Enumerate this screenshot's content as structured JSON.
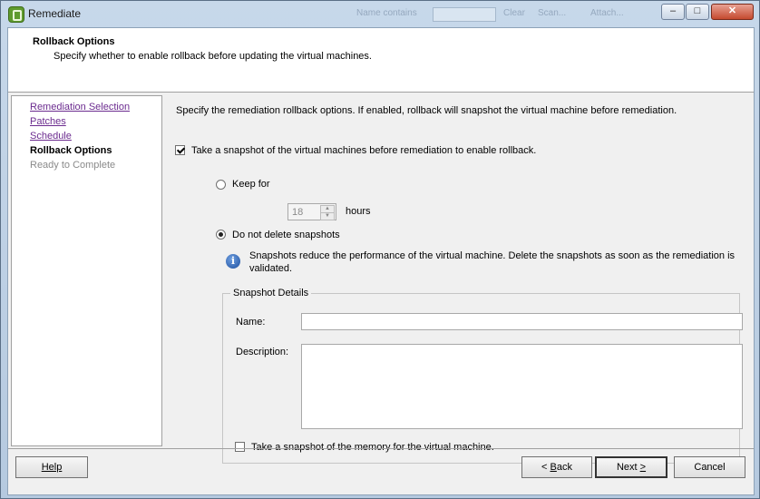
{
  "window": {
    "title": "Remediate",
    "ghost_text_1": "Name contains",
    "ghost_text_2": "Clear",
    "ghost_text_3": "Scan...",
    "ghost_text_4": "Attach...",
    "minimize_glyph": "–",
    "maximize_glyph": "□",
    "close_glyph": "✕"
  },
  "header": {
    "title": "Rollback Options",
    "subtitle": "Specify whether to enable rollback before updating the virtual machines."
  },
  "nav": {
    "items": [
      {
        "label": "Remediation Selection",
        "state": "link"
      },
      {
        "label": "Patches",
        "state": "link"
      },
      {
        "label": "Schedule",
        "state": "link"
      },
      {
        "label": "Rollback Options",
        "state": "current"
      },
      {
        "label": "Ready to Complete",
        "state": "disabled"
      }
    ]
  },
  "content": {
    "intro": "Specify the remediation rollback options. If enabled, rollback will snapshot the virtual machine before remediation.",
    "snapshot_checkbox": {
      "label": "Take a snapshot of the virtual machines before remediation to enable rollback.",
      "checked": true
    },
    "keep_for": {
      "label": "Keep for",
      "value": "18",
      "unit": "hours",
      "selected": false
    },
    "do_not_delete": {
      "label": "Do not delete snapshots",
      "selected": true
    },
    "info_icon": "info-icon",
    "info_text": "Snapshots reduce the performance of the virtual machine. Delete the snapshots as soon as the remediation is validated.",
    "details": {
      "legend": "Snapshot Details",
      "name_label": "Name:",
      "name_value": "",
      "description_label": "Description:",
      "description_value": "",
      "memory_checkbox": {
        "label": "Take a snapshot of the memory for the virtual machine.",
        "checked": false
      }
    }
  },
  "footer": {
    "help": "Help",
    "back_prefix": "< ",
    "back_key": "B",
    "back_rest": "ack",
    "next_prefix": "Next ",
    "next_key": ">",
    "cancel": "Cancel"
  },
  "colors": {
    "link": "#6b2b8f",
    "header_bg": "#ffffff",
    "dialog_bg": "#f0f0f0"
  }
}
